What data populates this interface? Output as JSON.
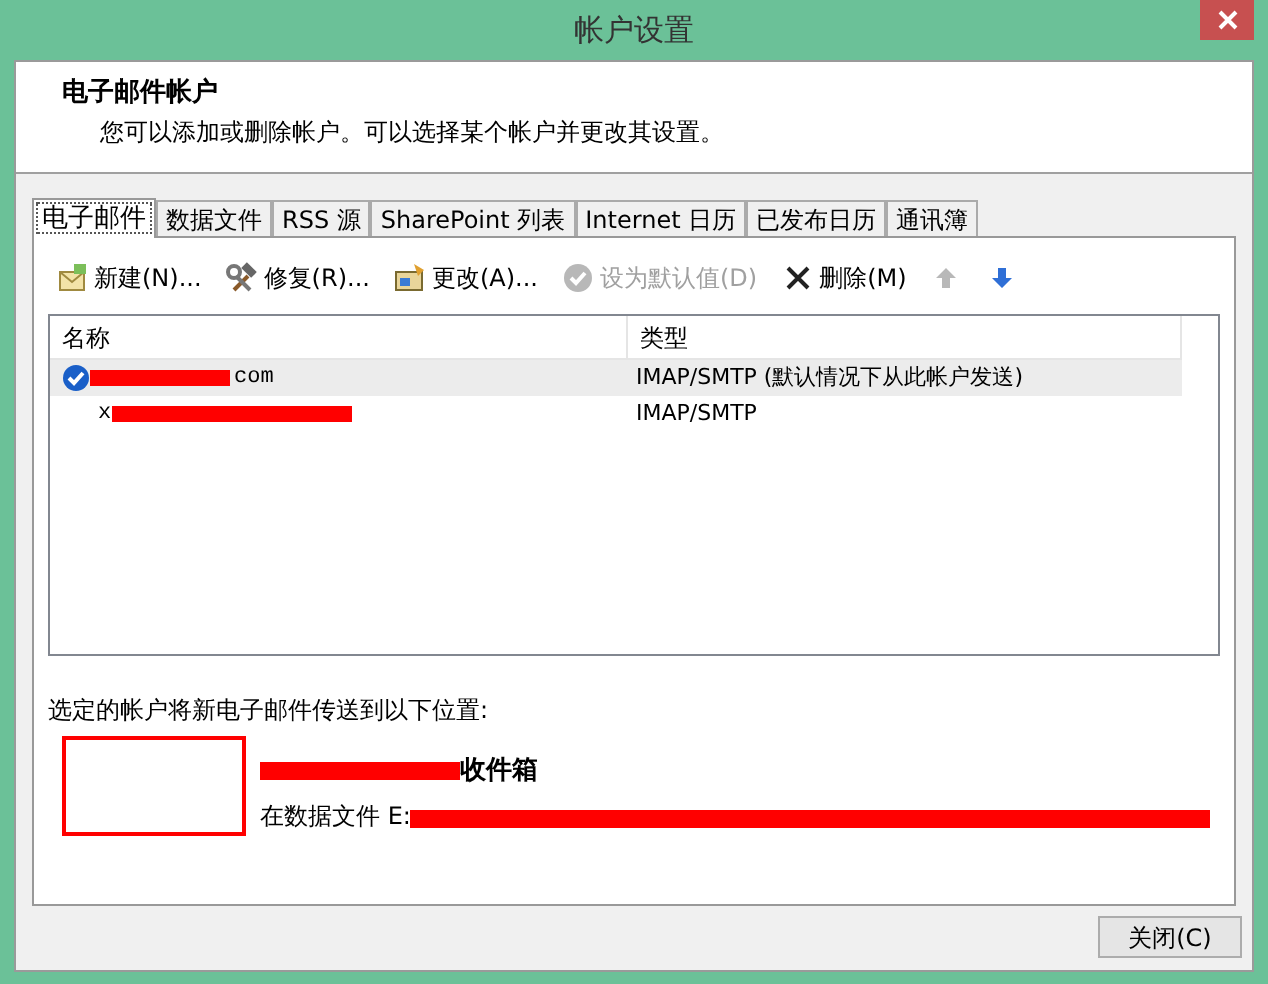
{
  "window": {
    "title": "帐户设置"
  },
  "header": {
    "title": "电子邮件帐户",
    "description": "您可以添加或删除帐户。可以选择某个帐户并更改其设置。"
  },
  "tabs": [
    {
      "label": "电子邮件",
      "selected": true
    },
    {
      "label": "数据文件",
      "selected": false
    },
    {
      "label": "RSS 源",
      "selected": false
    },
    {
      "label": "SharePoint 列表",
      "selected": false
    },
    {
      "label": "Internet 日历",
      "selected": false
    },
    {
      "label": "已发布日历",
      "selected": false
    },
    {
      "label": "通讯簿",
      "selected": false
    }
  ],
  "toolbar": [
    {
      "kind": "new",
      "label": "新建(N)...",
      "disabled": false
    },
    {
      "kind": "repair",
      "label": "修复(R)...",
      "disabled": false
    },
    {
      "kind": "change",
      "label": "更改(A)...",
      "disabled": false
    },
    {
      "kind": "default",
      "label": "设为默认值(D)",
      "disabled": true
    },
    {
      "kind": "delete",
      "label": "删除(M)",
      "disabled": false
    },
    {
      "kind": "up",
      "disabled": true
    },
    {
      "kind": "down",
      "disabled": false
    }
  ],
  "table": {
    "columns": [
      "名称",
      "类型"
    ],
    "rows": [
      {
        "name_prefix": "",
        "name_suffix": "com",
        "type": "IMAP/SMTP (默认情况下从此帐户发送)",
        "default": true,
        "selected": true
      },
      {
        "name_prefix": "x",
        "name_suffix": "",
        "type": "IMAP/SMTP",
        "default": false,
        "selected": false
      }
    ]
  },
  "delivery": {
    "label": "选定的帐户将新电子邮件传送到以下位置:",
    "folder": "收件箱",
    "path_prefix": "在数据文件 E:"
  },
  "close_button": "关闭(C)"
}
